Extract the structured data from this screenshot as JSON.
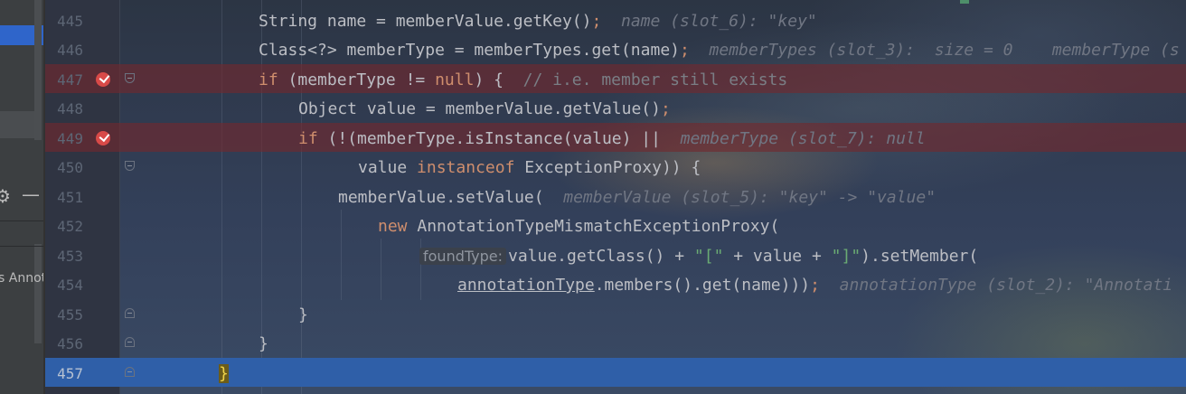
{
  "side_panel": {
    "truncated_label": "s Annot",
    "gear_icon": "gear-icon",
    "minus_icon": "minus-icon"
  },
  "colors": {
    "breakpoint_line": "#72282d",
    "current_line": "#2f5fa8",
    "keyword": "#cf8e6d",
    "string": "#6aab73",
    "comment": "#7a7e85",
    "inline_hint": "#707683"
  },
  "lines": [
    {
      "no": "445",
      "c1": "String name = memberValue.getKey()",
      "semi": ";",
      "hint": "name (slot_6): \"key\""
    },
    {
      "no": "446",
      "c1": "Class<?> memberType = memberTypes.get(name)",
      "semi": ";",
      "hint": "memberTypes (slot_3):  size = 0    memberType (s"
    },
    {
      "no": "447",
      "kw": "if",
      "c1": " (memberType != ",
      "kw2": "null",
      "c2": ") {  ",
      "comment": "// i.e. member still exists"
    },
    {
      "no": "448",
      "c1": "Object value = memberValue.getValue()",
      "semi": ";"
    },
    {
      "no": "449",
      "kw": "if",
      "c1": " (!(memberType.isInstance(value) ||  ",
      "hint": "memberType (slot_7): null"
    },
    {
      "no": "450",
      "c1": "value ",
      "kw": "instanceof",
      "c2": " ExceptionProxy)) {"
    },
    {
      "no": "451",
      "c1": "memberValue.setValue(  ",
      "hint": "memberValue (slot_5): \"key\" -> \"value\""
    },
    {
      "no": "452",
      "kw": "new",
      "c1": " AnnotationTypeMismatchExceptionProxy("
    },
    {
      "no": "453",
      "param": "foundType:",
      "c1": "value.getClass() + ",
      "s1": "\"[\"",
      "c2": " + value + ",
      "s2": "\"]\"",
      "c3": ").setMember("
    },
    {
      "no": "454",
      "u": "annotationType",
      "c1": ".members().get(name)))",
      "semi": ";",
      "hint": "annotationType (slot_2): \"Annotati"
    },
    {
      "no": "455",
      "c1": "}"
    },
    {
      "no": "456",
      "c1": "}"
    },
    {
      "no": "457",
      "c1": "}"
    }
  ]
}
